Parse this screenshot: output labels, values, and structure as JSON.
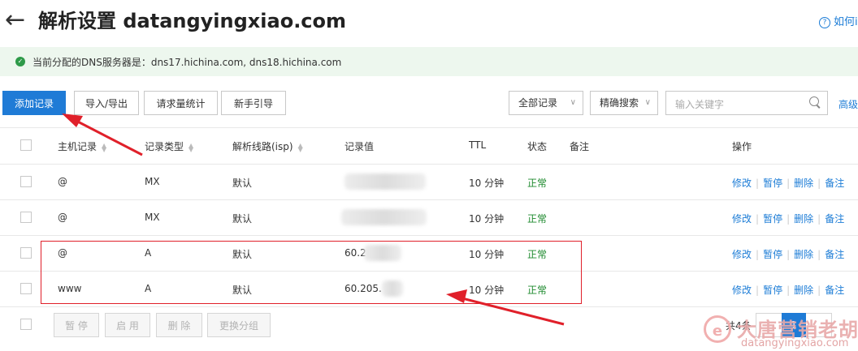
{
  "header": {
    "back_icon": "arrow-left-icon",
    "title": "解析设置 datangyingxiao.com",
    "help_label": "如何i"
  },
  "dns_notice": {
    "icon": "check-circle-icon",
    "text": "当前分配的DNS服务器是：dns17.hichina.com, dns18.hichina.com"
  },
  "toolbar": {
    "add_record": "添加记录",
    "import_export": "导入/导出",
    "request_stats": "请求量统计",
    "beginner_guide": "新手引导",
    "all_records": "全部记录",
    "exact_search": "精确搜索",
    "search_placeholder": "输入关键字",
    "advanced": "高级"
  },
  "table": {
    "headers": {
      "host": "主机记录",
      "type": "记录类型",
      "line": "解析线路(isp)",
      "value": "记录值",
      "ttl": "TTL",
      "status": "状态",
      "remark": "备注",
      "action": "操作"
    },
    "rows": [
      {
        "host": "@",
        "type": "MX",
        "line": "默认",
        "value": "",
        "ttl": "10 分钟",
        "status": "正常"
      },
      {
        "host": "@",
        "type": "MX",
        "line": "默认",
        "value": "",
        "ttl": "10 分钟",
        "status": "正常"
      },
      {
        "host": "@",
        "type": "A",
        "line": "默认",
        "value": "60.2",
        "ttl": "10 分钟",
        "status": "正常"
      },
      {
        "host": "www",
        "type": "A",
        "line": "默认",
        "value": "60.205.",
        "ttl": "10 分钟",
        "status": "正常"
      }
    ],
    "actions": {
      "edit": "修改",
      "pause": "暂停",
      "delete": "删除",
      "remark": "备注"
    }
  },
  "bottom": {
    "pause": "暂 停",
    "enable": "启 用",
    "delete": "删 除",
    "change_group": "更换分组",
    "total": "共4条",
    "page": "1"
  },
  "watermark": {
    "cn": "大唐营销老胡",
    "en": "datangyingxiao.com",
    "logo": "e"
  },
  "colors": {
    "accent": "#1f7bd6",
    "status_ok": "#1e8a2e",
    "annotation_red": "#e0202a",
    "notice_bg": "#edf7ee"
  }
}
